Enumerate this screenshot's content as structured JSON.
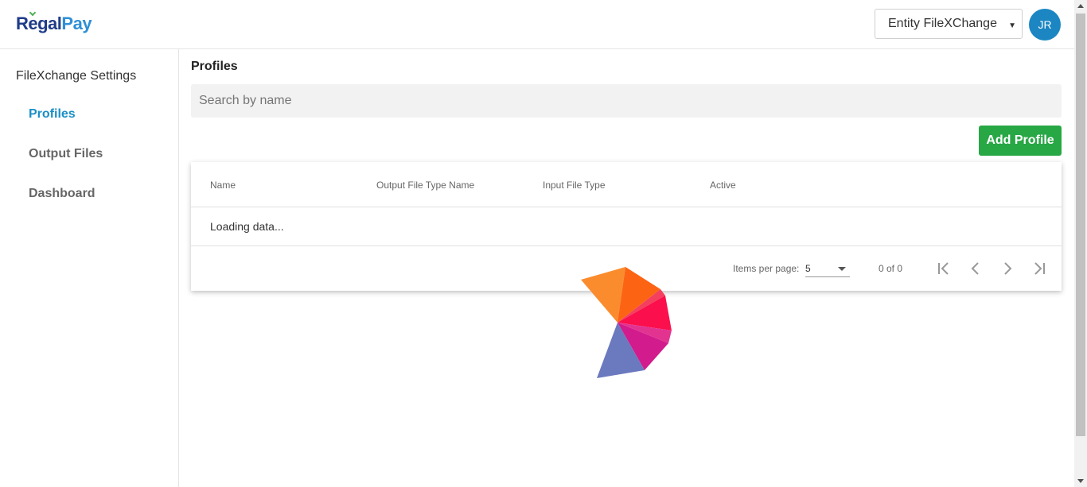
{
  "header": {
    "logo_regal": "Regal",
    "logo_pay": "Pay",
    "entity_select": "Entity FileXChange",
    "avatar_initials": "JR"
  },
  "sidebar": {
    "title": "FileXchange Settings",
    "items": [
      {
        "label": "Profiles",
        "active": true
      },
      {
        "label": "Output Files",
        "active": false
      },
      {
        "label": "Dashboard",
        "active": false
      }
    ]
  },
  "main": {
    "title": "Profiles",
    "search_placeholder": "Search by name",
    "add_button": "Add Profile"
  },
  "table": {
    "columns": [
      "Name",
      "Output File Type Name",
      "Input File Type",
      "Active"
    ],
    "loading_text": "Loading data...",
    "paginator": {
      "items_per_page_label": "Items per page:",
      "items_per_page_value": "5",
      "range_label": "0 of 0"
    }
  },
  "colors": {
    "accent": "#1a8fc6",
    "add_button": "#28a745",
    "avatar": "#1b86c2",
    "logo_dark": "#1f3c88",
    "logo_light": "#2f8fd6"
  },
  "icons": [
    "first-page-icon",
    "prev-page-icon",
    "next-page-icon",
    "last-page-icon",
    "dropdown-caret-icon",
    "loading-spinner-icon"
  ]
}
